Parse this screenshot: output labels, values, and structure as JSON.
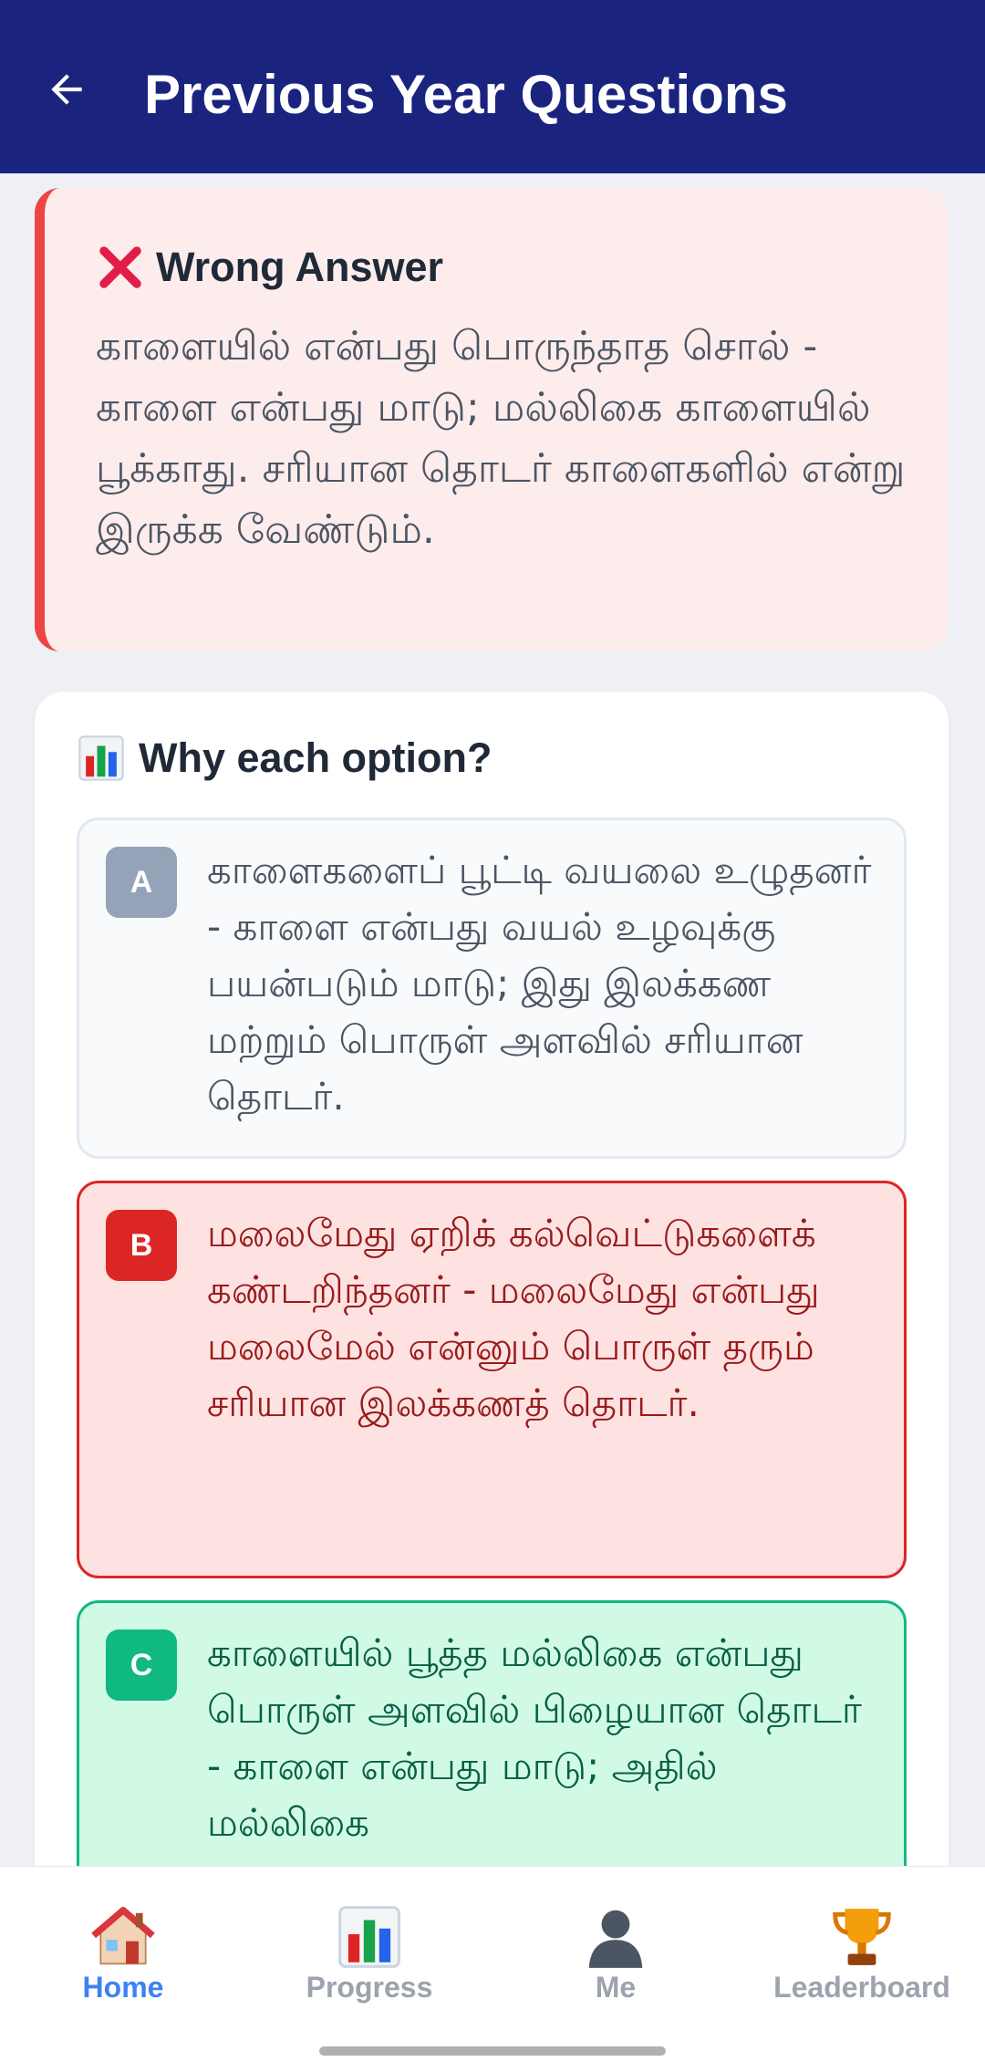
{
  "app_bar": {
    "title": "Previous Year Questions",
    "back_icon": "arrow-left-icon"
  },
  "wrong_answer": {
    "icon": "cross-mark-icon",
    "title": "Wrong Answer",
    "explanation": "காளையில் என்பது பொருந்தாத சொல் - காளை என்பது மாடு; மல்லிகை காளையில் பூக்காது. சரியான தொடர் காளைகளில் என்று இருக்க வேண்டும்.",
    "accent_color": "#ef4444"
  },
  "why_section": {
    "icon": "bar-chart-icon",
    "title": "Why each option?",
    "options": [
      {
        "letter": "A",
        "text": "காளைகளைப் பூட்டி வயலை உழுதனர் - காளை என்பது வயல் உழவுக்கு பயன்படும் மாடு; இது இலக்கண மற்றும் பொருள் அளவில் சரியான தொடர்.",
        "state": "neutral"
      },
      {
        "letter": "B",
        "text": "மலைமேது ஏறிக் கல்வெட்டுகளைக் கண்டறிந்தனர் - மலைமேது என்பது மலைமேல் என்னும் பொருள் தரும் சரியான இலக்கணத் தொடர்.",
        "state": "selected-wrong",
        "color": "#dc2626"
      },
      {
        "letter": "C",
        "text": "காளையில் பூத்த மல்லிகை என்பது பொருள் அளவில் பிழையான தொடர் - காளை என்பது மாடு; அதில் மல்லிகை",
        "state": "correct",
        "color": "#10b981"
      }
    ]
  },
  "bottom_nav": {
    "items": [
      {
        "label": "Home",
        "icon": "house-icon",
        "active": true
      },
      {
        "label": "Progress",
        "icon": "bar-chart-icon",
        "active": false
      },
      {
        "label": "Me",
        "icon": "person-silhouette-icon",
        "active": false
      },
      {
        "label": "Leaderboard",
        "icon": "trophy-icon",
        "active": false
      }
    ],
    "active_color": "#3b82f6"
  }
}
